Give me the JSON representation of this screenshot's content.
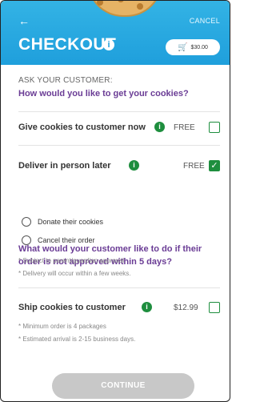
{
  "header": {
    "back_icon": "arrow-left-icon",
    "cancel_label": "CANCEL",
    "title": "CHECKOUT",
    "info_icon": "info-icon",
    "cart_icon": "cart-icon",
    "cart_amount": "$30.00"
  },
  "prompt": {
    "ask_label": "ASK YOUR CUSTOMER:",
    "question": "How would you like to get your cookies?"
  },
  "options": {
    "give_now": {
      "label": "Give cookies to customer now",
      "price": "FREE",
      "checked": false
    },
    "deliver_later": {
      "label": "Deliver in person later",
      "price": "FREE",
      "checked": true,
      "sub_question": "What would your customer like to do if their order is not approved within 5 days?",
      "radios": [
        {
          "label": "Donate their cookies",
          "selected": false
        },
        {
          "label": "Cancel their order",
          "selected": false
        }
      ],
      "notes": [
        "* Subject to parent/guardian approval",
        "* Delivery will occur within a few weeks."
      ]
    },
    "ship": {
      "label": "Ship cookies to customer",
      "price": "$12.99",
      "checked": false,
      "notes": [
        "* Minimum order is 4 packages",
        "* Estimated arrival is 2-15 business days."
      ]
    }
  },
  "footer": {
    "continue_label": "CONTINUE"
  },
  "colors": {
    "header_blue": "#1f9fdc",
    "accent_green": "#1e8e3e",
    "question_purple": "#6a3c95",
    "button_disabled": "#c8c8c8"
  }
}
